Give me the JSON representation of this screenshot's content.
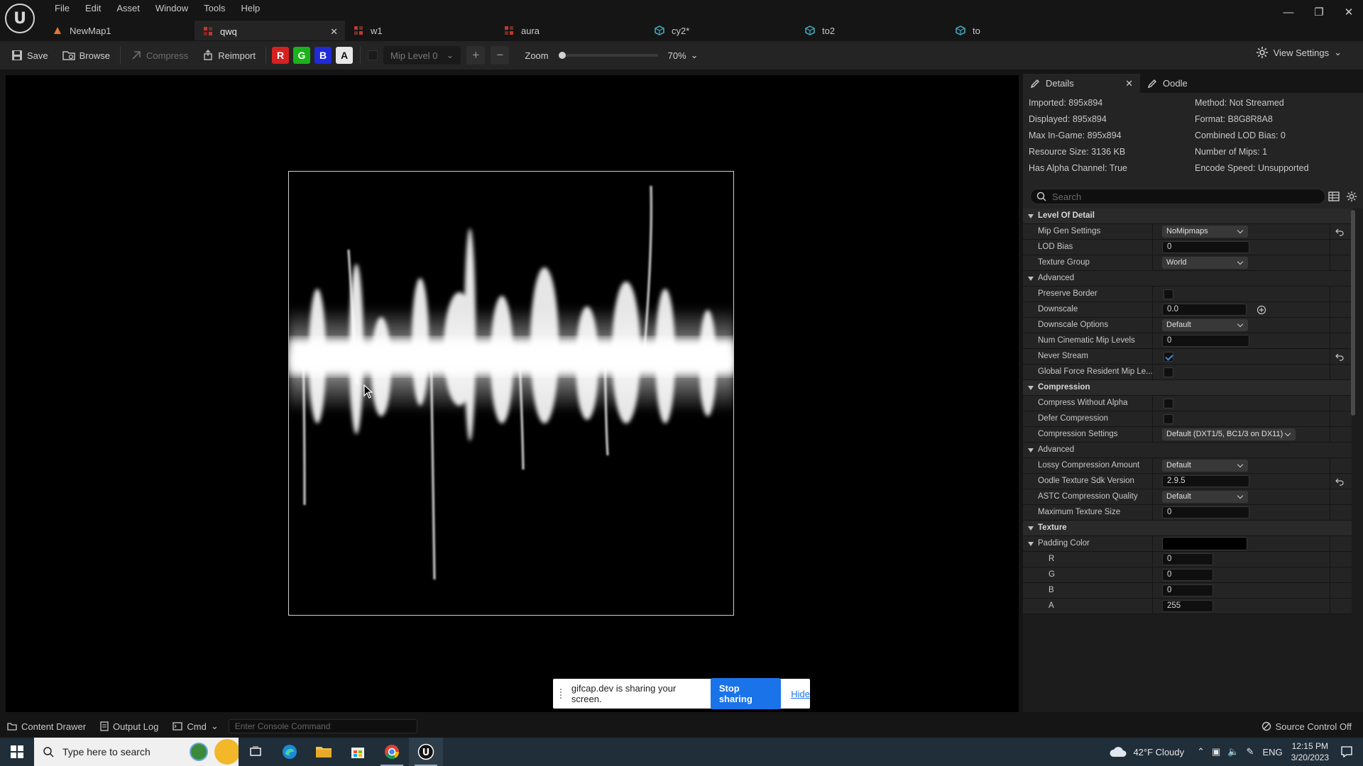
{
  "menu": [
    "File",
    "Edit",
    "Asset",
    "Window",
    "Tools",
    "Help"
  ],
  "tabs": [
    {
      "label": "NewMap1",
      "icon": "level-icon"
    },
    {
      "label": "qwq",
      "icon": "texture-icon",
      "active": true
    },
    {
      "label": "w1",
      "icon": "texture-icon"
    },
    {
      "label": "aura",
      "icon": "texture-icon"
    },
    {
      "label": "cy2*",
      "icon": "material-icon"
    },
    {
      "label": "to2",
      "icon": "material-icon"
    },
    {
      "label": "to",
      "icon": "material-icon"
    }
  ],
  "toolbar": {
    "save": "Save",
    "browse": "Browse",
    "compress": "Compress",
    "reimport": "Reimport",
    "channels": [
      "R",
      "G",
      "B",
      "A"
    ],
    "mip_level": "Mip Level 0",
    "zoom_label": "Zoom",
    "zoom_value": "70%",
    "zoom_fraction": 0.0,
    "view_settings": "View Settings"
  },
  "details": {
    "tab_details": "Details",
    "tab_oodle": "Oodle",
    "info_left": [
      "Imported: 895x894",
      "Displayed: 895x894",
      "Max In-Game: 895x894",
      "Resource Size: 3136 KB",
      "Has Alpha Channel: True"
    ],
    "info_right": [
      "Method: Not Streamed",
      "Format: B8G8R8A8",
      "Combined LOD Bias: 0",
      "Number of Mips: 1",
      "Encode Speed: Unsupported"
    ],
    "search_placeholder": "Search",
    "rows": [
      {
        "label": "Level Of Detail",
        "type": "category",
        "indent": 0
      },
      {
        "label": "Mip Gen Settings",
        "type": "select",
        "value": "NoMipmaps",
        "indent": 1,
        "reset": true
      },
      {
        "label": "LOD Bias",
        "type": "input",
        "value": "0",
        "indent": 1
      },
      {
        "label": "Texture Group",
        "type": "select",
        "value": "World",
        "indent": 1
      },
      {
        "label": "Advanced",
        "type": "subcat",
        "indent": 0
      },
      {
        "label": "Preserve Border",
        "type": "check",
        "value": false,
        "indent": 1
      },
      {
        "label": "Downscale",
        "type": "input",
        "value": "0.0",
        "indent": 1,
        "plus": true
      },
      {
        "label": "Downscale Options",
        "type": "select",
        "value": "Default",
        "indent": 1
      },
      {
        "label": "Num Cinematic Mip Levels",
        "type": "input",
        "value": "0",
        "indent": 1
      },
      {
        "label": "Never Stream",
        "type": "check",
        "value": true,
        "indent": 1,
        "reset": true
      },
      {
        "label": "Global Force Resident Mip Le...",
        "type": "check",
        "value": false,
        "indent": 1
      },
      {
        "label": "Compression",
        "type": "category",
        "indent": 0
      },
      {
        "label": "Compress Without Alpha",
        "type": "check",
        "value": false,
        "indent": 1
      },
      {
        "label": "Defer Compression",
        "type": "check",
        "value": false,
        "indent": 1
      },
      {
        "label": "Compression Settings",
        "type": "select-wide",
        "value": "Default (DXT1/5, BC1/3 on DX11)",
        "indent": 1
      },
      {
        "label": "Advanced",
        "type": "subcat",
        "indent": 0
      },
      {
        "label": "Lossy Compression Amount",
        "type": "select",
        "value": "Default",
        "indent": 1
      },
      {
        "label": "Oodle Texture Sdk Version",
        "type": "input",
        "value": "2.9.5",
        "indent": 1,
        "reset": true
      },
      {
        "label": "ASTC Compression Quality",
        "type": "select",
        "value": "Default",
        "indent": 1
      },
      {
        "label": "Maximum Texture Size",
        "type": "input",
        "value": "0",
        "indent": 1
      },
      {
        "label": "Texture",
        "type": "category",
        "indent": 0
      },
      {
        "label": "Padding Color",
        "type": "color",
        "value": "#000000",
        "indent": 0,
        "expand": true
      },
      {
        "label": "R",
        "type": "input-small",
        "value": "0",
        "indent": 2
      },
      {
        "label": "G",
        "type": "input-small",
        "value": "0",
        "indent": 2
      },
      {
        "label": "B",
        "type": "input-small",
        "value": "0",
        "indent": 2
      },
      {
        "label": "A",
        "type": "input-small",
        "value": "255",
        "indent": 2
      }
    ]
  },
  "share": {
    "message": "gifcap.dev is sharing your screen.",
    "stop": "Stop sharing",
    "hide": "Hide"
  },
  "status": {
    "content_drawer": "Content Drawer",
    "output_log": "Output Log",
    "cmd": "Cmd",
    "console_placeholder": "Enter Console Command",
    "source_control": "Source Control Off"
  },
  "taskbar": {
    "search_placeholder": "Type here to search",
    "weather": "42°F  Cloudy",
    "lang": "ENG",
    "time": "12:15 PM",
    "date": "3/20/2023"
  },
  "colors": {
    "channel_r": "#d62121",
    "channel_g": "#1bb21b",
    "channel_b": "#1f2bd8",
    "channel_a": "#e8e8e8",
    "stop_sharing": "#1a73e8",
    "taskbar": "#202e39"
  }
}
